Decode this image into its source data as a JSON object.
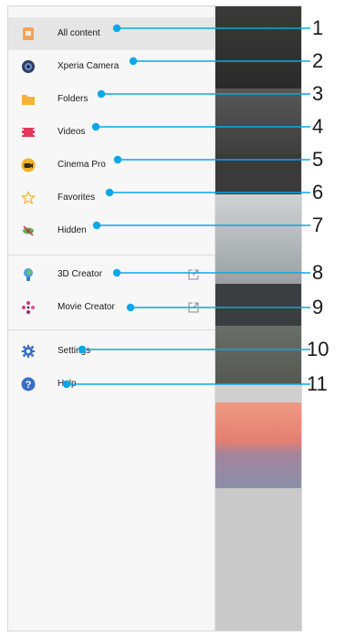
{
  "menu": {
    "items": [
      {
        "label": "All content",
        "icon": "all-content-icon"
      },
      {
        "label": "Xperia Camera",
        "icon": "xperia-camera-icon"
      },
      {
        "label": "Folders",
        "icon": "folder-icon"
      },
      {
        "label": "Videos",
        "icon": "film-icon"
      },
      {
        "label": "Cinema Pro",
        "icon": "cinema-pro-icon"
      },
      {
        "label": "Favorites",
        "icon": "star-icon"
      },
      {
        "label": "Hidden",
        "icon": "hidden-eye-icon"
      },
      {
        "label": "3D Creator",
        "icon": "3d-creator-icon"
      },
      {
        "label": "Movie Creator",
        "icon": "movie-creator-icon"
      },
      {
        "label": "Settings",
        "icon": "gear-icon"
      },
      {
        "label": "Help",
        "icon": "help-icon"
      }
    ]
  },
  "callouts": [
    "1",
    "2",
    "3",
    "4",
    "5",
    "6",
    "7",
    "8",
    "9",
    "10",
    "11"
  ],
  "colors": {
    "accent": "#0aa8e8",
    "selected_bg": "#e6e6e6",
    "drawer_bg": "#f7f7f7"
  }
}
